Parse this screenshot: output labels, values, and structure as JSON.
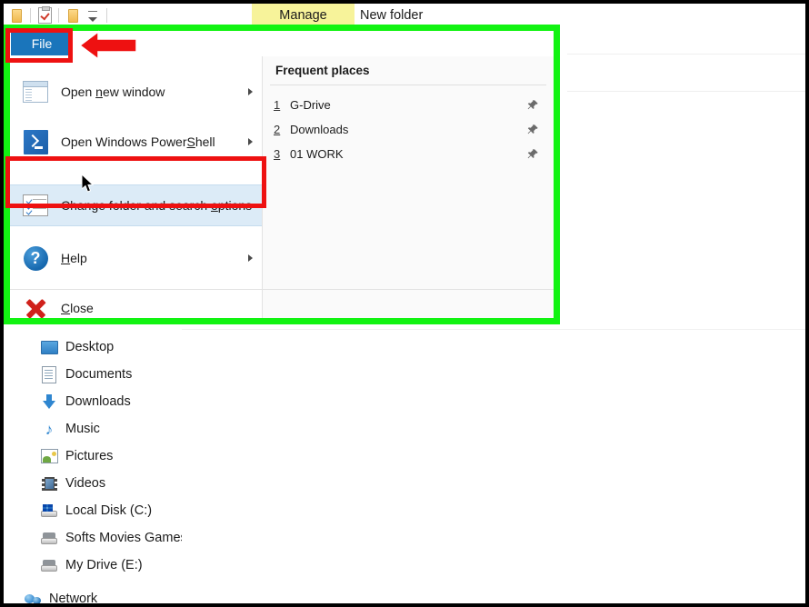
{
  "window": {
    "title": "New folder",
    "manage_tab": "Manage",
    "manage_tab_underline_char": "g"
  },
  "quick_access": {
    "items": [
      {
        "name": "folder-icon",
        "label": "Pin to Quick access"
      },
      {
        "name": "properties-icon",
        "label": "Properties"
      },
      {
        "name": "folder-icon",
        "label": "New folder"
      },
      {
        "name": "customize-caret-icon",
        "label": "Customize Quick Access Toolbar"
      }
    ]
  },
  "backstage": {
    "file_tab_label": "File",
    "menu_items": [
      {
        "id": "open-new-window",
        "label_pre": "Open ",
        "label_key": "n",
        "label_post": "ew window",
        "icon": "new-window-icon",
        "has_submenu": true,
        "selected": false
      },
      {
        "id": "open-windows-powershell",
        "label_pre": "Open Windows Power",
        "label_key": "S",
        "label_post": "hell",
        "icon": "powershell-icon",
        "has_submenu": true,
        "selected": false
      },
      {
        "id": "change-folder-and-search-options",
        "label_pre": "Change folder and search ",
        "label_key": "o",
        "label_post": "ptions",
        "icon": "folder-options-icon",
        "has_submenu": false,
        "selected": true
      },
      {
        "id": "help",
        "label_pre": "",
        "label_key": "H",
        "label_post": "elp",
        "icon": "help-icon",
        "has_submenu": true,
        "selected": false
      },
      {
        "id": "close",
        "label_pre": "",
        "label_key": "C",
        "label_post": "lose",
        "icon": "close-x-icon",
        "has_submenu": false,
        "selected": false
      }
    ],
    "frequent_places": {
      "title": "Frequent places",
      "items": [
        {
          "number": "1",
          "name": "G-Drive",
          "pin": "pin-icon"
        },
        {
          "number": "2",
          "name": "Downloads",
          "pin": "pin-icon"
        },
        {
          "number": "3",
          "name": "01 WORK",
          "pin": "pin-icon"
        }
      ]
    }
  },
  "nav_pane": {
    "items": [
      {
        "label": "Desktop",
        "icon": "desktop-icon",
        "indent": "child"
      },
      {
        "label": "Documents",
        "icon": "documents-icon",
        "indent": "child"
      },
      {
        "label": "Downloads",
        "icon": "downloads-icon",
        "indent": "child"
      },
      {
        "label": "Music",
        "icon": "music-icon",
        "indent": "child"
      },
      {
        "label": "Pictures",
        "icon": "pictures-icon",
        "indent": "child"
      },
      {
        "label": "Videos",
        "icon": "videos-icon",
        "indent": "child"
      },
      {
        "label": "Local Disk (C:)",
        "icon": "local-disk-icon",
        "indent": "child"
      },
      {
        "label": "Softs Movies Games",
        "icon": "drive-icon",
        "indent": "child"
      },
      {
        "label": "My Drive (E:)",
        "icon": "drive-icon",
        "indent": "child"
      },
      {
        "label": "Network",
        "icon": "network-icon",
        "indent": "root"
      }
    ]
  },
  "annotations": {
    "green_highlight_color": "#12f312",
    "red_highlight_color": "#ee1111",
    "arrow": "left-arrow-annotation",
    "boxes": [
      "file-tab-highlight",
      "change-folder-options-highlight"
    ]
  },
  "colors": {
    "file_tab_blue": "#1a75bb",
    "manage_tab_yellow": "#f7f39a",
    "selected_item_blue": "#dcebf7"
  }
}
